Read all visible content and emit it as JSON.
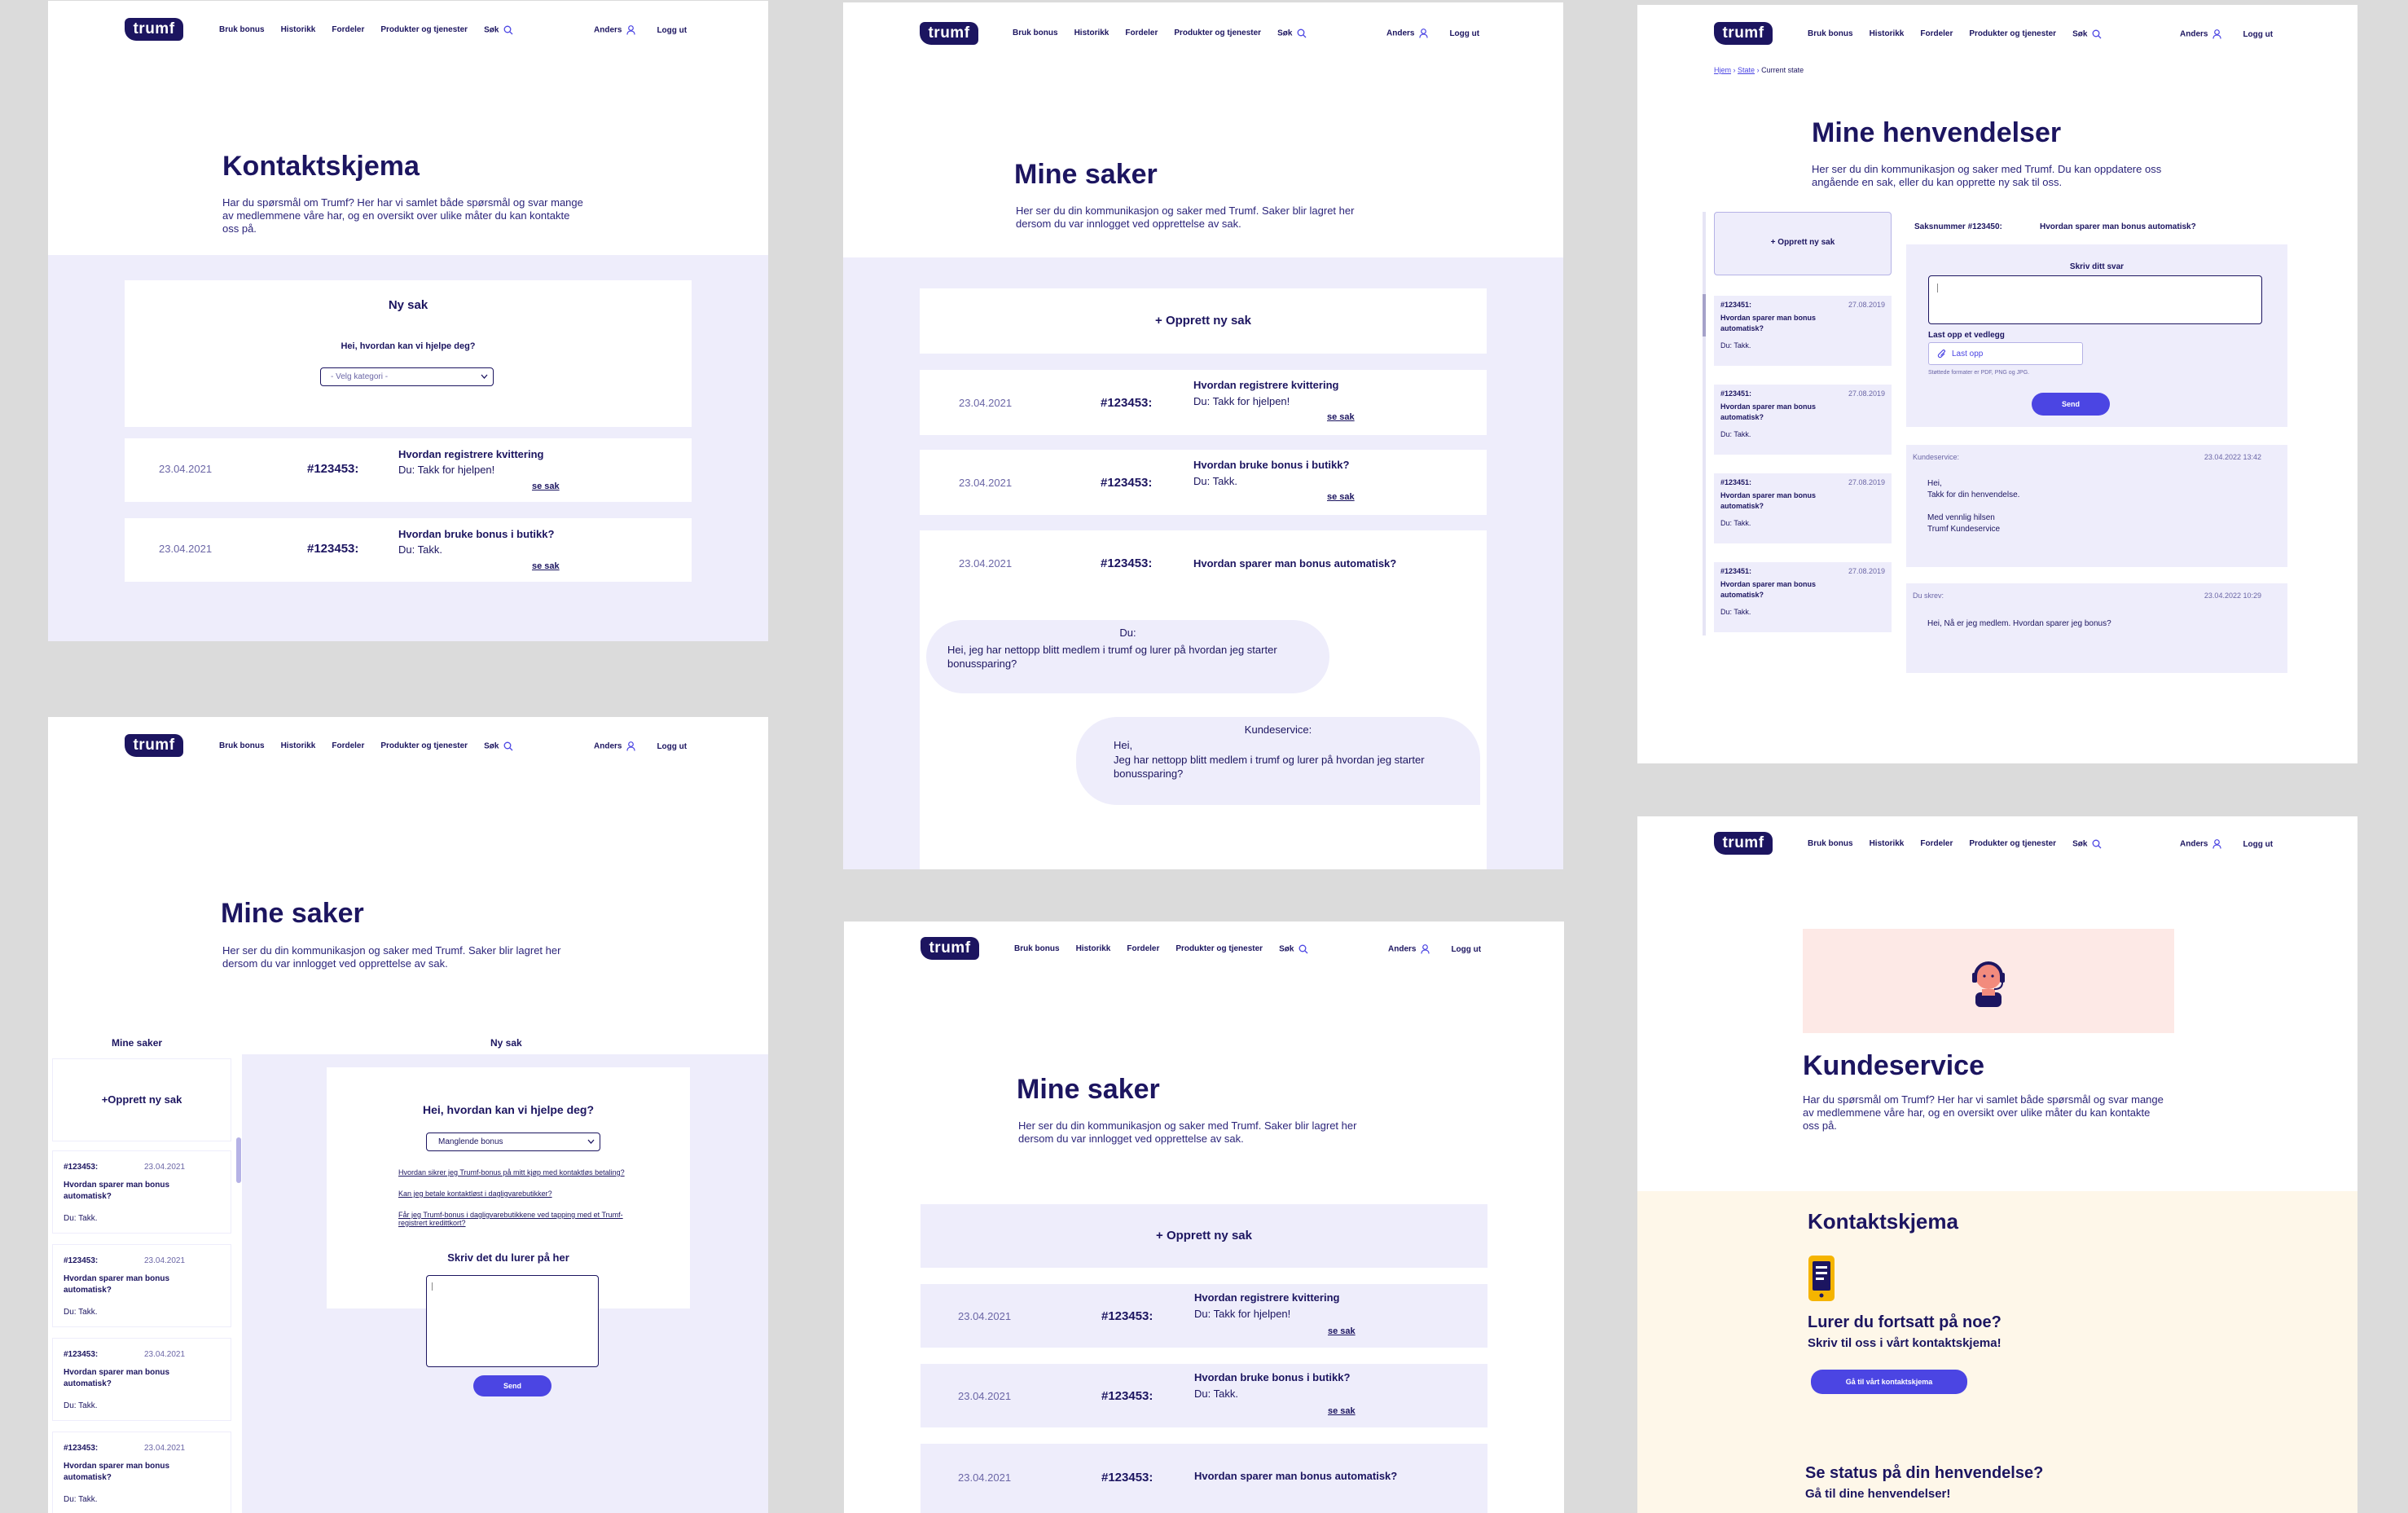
{
  "nav": {
    "logo": "trumf",
    "links": [
      "Bruk bonus",
      "Historikk",
      "Fordeler",
      "Produkter og tjenester"
    ],
    "search": "Søk",
    "user": "Anders",
    "logout": "Logg ut"
  },
  "p1": {
    "title": "Kontaktskjema",
    "intro": "Har du spørsmål om Trumf? Her har vi samlet både spørsmål og svar mange av medlemmene våre har, og en oversikt over ulike måter du kan kontakte oss på.",
    "card_title": "Ny sak",
    "help": "Hei, hvordan kan vi hjelpe deg?",
    "select": "- Velg kategori -",
    "cases": [
      {
        "date": "23.04.2021",
        "num": "#123453:",
        "q": "Hvordan registrere kvittering",
        "a": "Du: Takk for hjelpen!",
        "link": "se sak"
      },
      {
        "date": "23.04.2021",
        "num": "#123453:",
        "q": "Hvordan bruke bonus i butikk?",
        "a": "Du: Takk.",
        "link": "se sak"
      }
    ]
  },
  "p2": {
    "title": "Mine saker",
    "intro": "Her ser du din kommunikasjon og saker med Trumf. Saker blir lagret her dersom du var innlogget ved opprettelse av sak.",
    "new": "+ Opprett ny sak",
    "cases": [
      {
        "date": "23.04.2021",
        "num": "#123453:",
        "q": "Hvordan registrere kvittering",
        "a": "Du: Takk for hjelpen!",
        "link": "se sak"
      },
      {
        "date": "23.04.2021",
        "num": "#123453:",
        "q": "Hvordan bruke bonus i butikk?",
        "a": "Du: Takk.",
        "link": "se sak"
      },
      {
        "date": "23.04.2021",
        "num": "#123453:",
        "q": "Hvordan sparer man bonus automatisk?"
      }
    ],
    "bubble1_who": "Du:",
    "bubble1_text": "Hei, jeg har nettopp blitt medlem i trumf og lurer på hvordan jeg starter bonussparing?",
    "bubble2_who": "Kundeservice:",
    "bubble2_text1": "Hei,",
    "bubble2_text2": "Jeg har nettopp blitt medlem i trumf og lurer på hvordan jeg starter bonussparing?"
  },
  "p3": {
    "crumbs": [
      "Hjem",
      "State",
      "Current state"
    ],
    "title": "Mine henvendelser",
    "intro": "Her ser du din kommunikasjon og saker med Trumf. Du kan oppdatere oss angående en sak, eller du kan opprette ny sak til oss.",
    "new": "+ Opprett ny sak",
    "saksnr": "Saksnummer #123450:",
    "saksq": "Hvordan sparer man bonus automatisk?",
    "svar_label": "Skriv ditt svar",
    "upload_label": "Last opp et vedlegg",
    "upload_btn": "Last opp",
    "formats": "Støttede formater er PDF, PNG og JPG.",
    "send": "Send",
    "list": [
      {
        "num": "#123451:",
        "date": "27.08.2019",
        "q": "Hvordan sparer man bonus automatisk?",
        "a": "Du: Takk."
      },
      {
        "num": "#123451:",
        "date": "27.08.2019",
        "q": "Hvordan sparer man bonus automatisk?",
        "a": "Du: Takk."
      },
      {
        "num": "#123451:",
        "date": "27.08.2019",
        "q": "Hvordan sparer man bonus automatisk?",
        "a": "Du: Takk."
      },
      {
        "num": "#123451:",
        "date": "27.08.2019",
        "q": "Hvordan sparer man bonus automatisk?",
        "a": "Du: Takk."
      }
    ],
    "msg1_who": "Kundeservice:",
    "msg1_date": "23.04.2022 13:42",
    "msg1_l1": "Hei,",
    "msg1_l2": "Takk for din henvendelse.",
    "msg1_l3": "Med vennlig hilsen",
    "msg1_l4": "Trumf Kundeservice",
    "msg2_who": "Du skrev:",
    "msg2_date": "23.04.2022 10:29",
    "msg2_text": "Hei, Nå er jeg medlem. Hvordan sparer jeg bonus?"
  },
  "p4": {
    "title": "Mine saker",
    "intro": "Her ser du din kommunikasjon og saker med Trumf. Saker blir lagret her dersom du var innlogget ved opprettelse av sak.",
    "tab_left": "Mine saker",
    "tab_right": "Ny sak",
    "new": "+Opprett ny sak",
    "list": [
      {
        "num": "#123453:",
        "date": "23.04.2021",
        "q": "Hvordan sparer man bonus automatisk?",
        "a": "Du: Takk."
      },
      {
        "num": "#123453:",
        "date": "23.04.2021",
        "q": "Hvordan sparer man bonus automatisk?",
        "a": "Du: Takk."
      },
      {
        "num": "#123453:",
        "date": "23.04.2021",
        "q": "Hvordan sparer man bonus automatisk?",
        "a": "Du: Takk."
      },
      {
        "num": "#123453:",
        "date": "23.04.2021",
        "q": "Hvordan sparer man bonus automatisk?",
        "a": "Du: Takk."
      }
    ],
    "help": "Hei, hvordan kan vi hjelpe deg?",
    "select": "Manglende bonus",
    "links": [
      "Hvordan sikrer jeg Trumf-bonus på mitt kjøp med kontaktløs betaling?",
      "Kan jeg betale kontaktløst i dagligvarebutikker?",
      "Får jeg Trumf-bonus i dagligvarebutikkene ved tapping med et Trumf-registrert kredittkort?"
    ],
    "write": "Skriv det du lurer på her",
    "send": "Send"
  },
  "p5": {
    "title": "Mine saker",
    "intro": "Her ser du din kommunikasjon og saker med Trumf. Saker blir lagret her dersom du var innlogget ved opprettelse av sak.",
    "new": "+ Opprett ny sak",
    "cases": [
      {
        "date": "23.04.2021",
        "num": "#123453:",
        "q": "Hvordan registrere kvittering",
        "a": "Du: Takk for hjelpen!",
        "link": "se sak"
      },
      {
        "date": "23.04.2021",
        "num": "#123453:",
        "q": "Hvordan bruke bonus i butikk?",
        "a": "Du: Takk.",
        "link": "se sak"
      },
      {
        "date": "23.04.2021",
        "num": "#123453:",
        "q": "Hvordan sparer man bonus automatisk?"
      }
    ]
  },
  "p6": {
    "title": "Kundeservice",
    "intro": "Har du spørsmål om Trumf? Her har vi samlet både spørsmål og svar mange av medlemmene våre har, og en oversikt over ulike måter du kan kontakte oss på.",
    "section": "Kontaktskjema",
    "lurer": "Lurer du fortsatt på noe?",
    "skriv": "Skriv til oss i vårt kontaktskjema!",
    "btn": "Gå til vårt kontaktskjema",
    "status": "Se status på din henvendelse?",
    "gaa": "Gå til dine henvendelser!"
  }
}
